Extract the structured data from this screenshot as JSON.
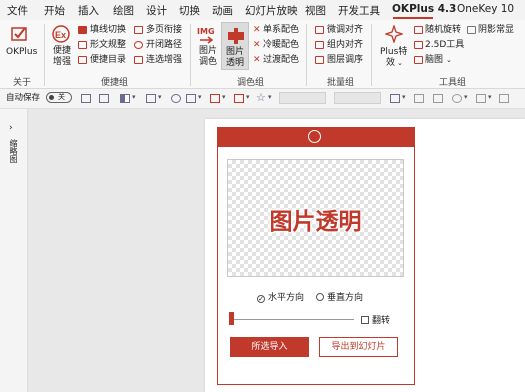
{
  "tabs": [
    "文件",
    "开始",
    "插入",
    "绘图",
    "设计",
    "切换",
    "动画",
    "幻灯片放映",
    "视图",
    "开发工具",
    "OKPlus 4.3",
    "OneKey 10"
  ],
  "ribbon": {
    "group_about": {
      "label": "关于",
      "okplus": "OKPlus"
    },
    "group_quick": {
      "label": "便捷组",
      "big": [
        "便捷",
        "增强"
      ],
      "items": [
        "填线切换",
        "形文规整",
        "便捷目录",
        "多页衔接",
        "开闭路径",
        "连选增强"
      ]
    },
    "group_color": {
      "label": "调色组",
      "img_badge": "IMG",
      "img_color": [
        "图片",
        "调色"
      ],
      "img_transparent": [
        "图片",
        "透明"
      ],
      "items": [
        "单系配色",
        "冷暖配色",
        "过渡配色"
      ]
    },
    "group_batch": {
      "label": "批量组",
      "items": [
        "微调对齐",
        "组内对齐",
        "图层调序"
      ]
    },
    "group_tools": {
      "label": "工具组",
      "plus": [
        "Plus特",
        "效"
      ],
      "items": [
        "随机旋转",
        "2.5D工具",
        "脑图",
        "阴影常显"
      ]
    }
  },
  "qat": {
    "autosave": "自动保存",
    "toggle": "关"
  },
  "side": {
    "thumbnails": "缩略图"
  },
  "dialog": {
    "preview_text": "图片透明",
    "horizontal": "水平方向",
    "vertical": "垂直方向",
    "flip": "翻转",
    "import_btn": "所选导入",
    "export_btn": "导出到幻灯片",
    "slider_value": 0
  },
  "colors": {
    "accent": "#c0392b"
  }
}
